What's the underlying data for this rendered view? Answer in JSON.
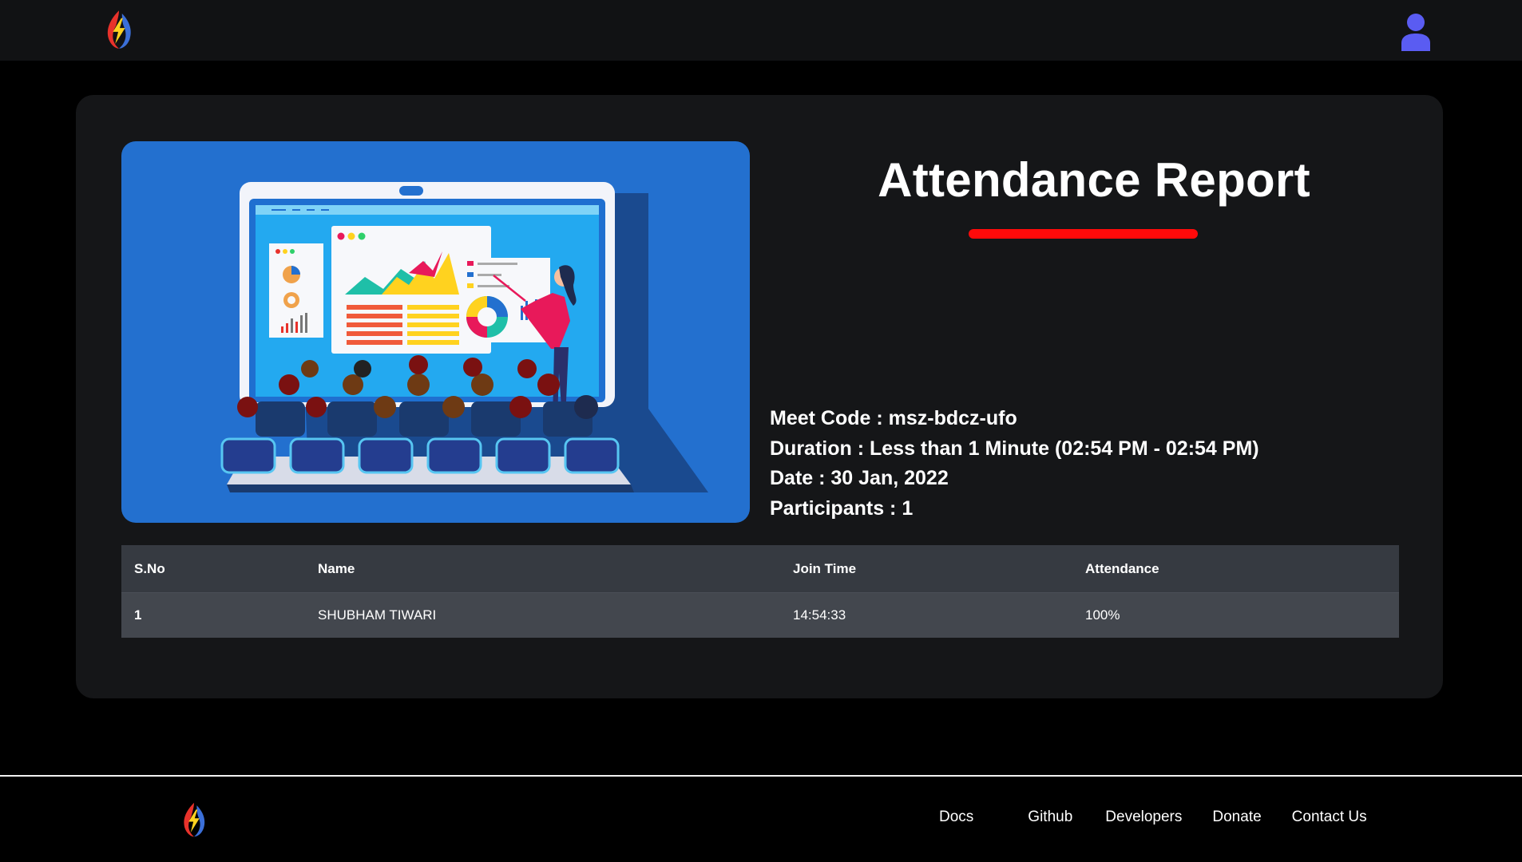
{
  "header": {
    "logo": "lightning-logo",
    "account": "user-icon"
  },
  "report": {
    "title": "Attendance Report",
    "accent_color": "#ff0a0a",
    "meet_code": "Meet Code : msz-bdcz-ufo",
    "duration": "Duration : Less than 1 Minute (02:54 PM - 02:54 PM)",
    "date": "Date : 30 Jan, 2022",
    "participants": "Participants : 1"
  },
  "table": {
    "headers": [
      "S.No",
      "Name",
      "Join Time",
      "Attendance"
    ],
    "rows": [
      [
        "1",
        "SHUBHAM TIWARI",
        "14:54:33",
        "100%"
      ]
    ]
  },
  "footer": {
    "logo": "lightning-logo",
    "links": [
      "Docs",
      "Github",
      "Developers",
      "Donate",
      "Contact Us"
    ]
  }
}
